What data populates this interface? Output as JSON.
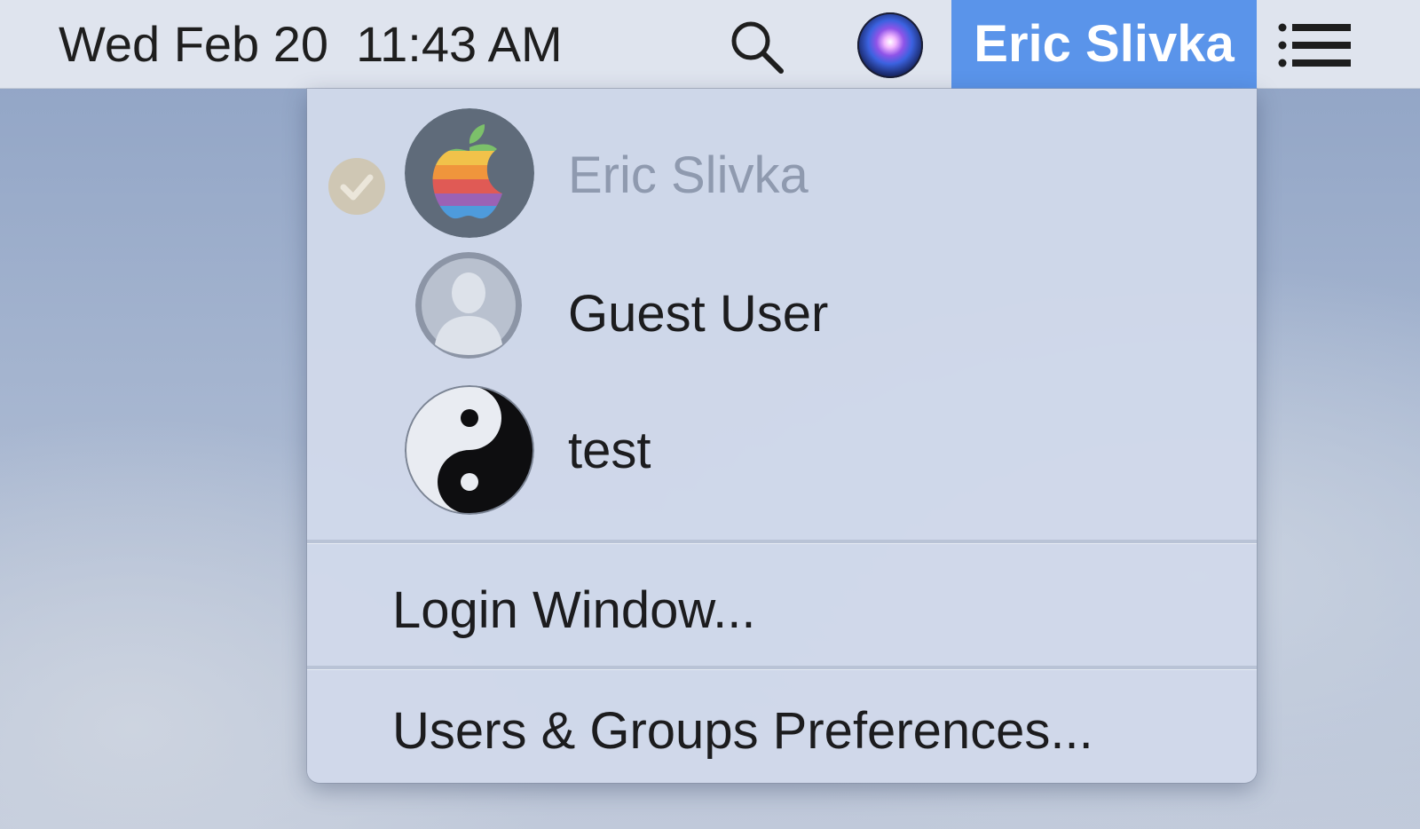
{
  "menubar": {
    "clock": "Wed Feb 20  11:43 AM",
    "search_icon": "magnifying-glass",
    "siri_icon": "siri-orb",
    "current_user": "Eric Slivka",
    "list_icon": "notification-list",
    "highlight_color": "#5a94ea"
  },
  "user_menu": {
    "users": [
      {
        "name": "Eric Slivka",
        "avatar": "rainbow-apple-logo",
        "logged_in": true
      },
      {
        "name": "Guest User",
        "avatar": "generic-silhouette",
        "logged_in": false
      },
      {
        "name": "test",
        "avatar": "yin-yang",
        "logged_in": false
      }
    ],
    "actions": [
      {
        "label": "Login Window..."
      },
      {
        "label": "Users & Groups Preferences..."
      }
    ]
  }
}
